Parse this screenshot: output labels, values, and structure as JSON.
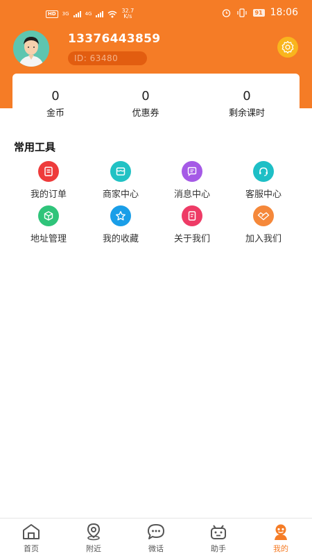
{
  "status_bar": {
    "left_badges": [
      "HD",
      "3G",
      "4G"
    ],
    "speed_value": "32.7",
    "speed_unit": "K/s",
    "battery": "91",
    "time": "18:06"
  },
  "profile": {
    "phone": "13376443859",
    "id_label": "ID: 63480",
    "settings_icon": "gear-icon"
  },
  "stats": [
    {
      "value": "0",
      "label": "金币"
    },
    {
      "value": "0",
      "label": "优惠券"
    },
    {
      "value": "0",
      "label": "剩余课时"
    }
  ],
  "tools": {
    "title": "常用工具",
    "items": [
      {
        "label": "我的订单",
        "icon": "order-icon",
        "color": "#ee3b3b"
      },
      {
        "label": "商家中心",
        "icon": "shop-icon",
        "color": "#21c2c4"
      },
      {
        "label": "消息中心",
        "icon": "message-icon",
        "color": "#a55ae6"
      },
      {
        "label": "客服中心",
        "icon": "headset-icon",
        "color": "#1ebfc6"
      },
      {
        "label": "地址管理",
        "icon": "box-icon",
        "color": "#2fc47a"
      },
      {
        "label": "我的收藏",
        "icon": "star-icon",
        "color": "#1a9ee8"
      },
      {
        "label": "关于我们",
        "icon": "document-icon",
        "color": "#ee3b66"
      },
      {
        "label": "加入我们",
        "icon": "handshake-icon",
        "color": "#f5883a"
      }
    ]
  },
  "bottom_nav": {
    "items": [
      {
        "label": "首页",
        "icon": "home-icon"
      },
      {
        "label": "附近",
        "icon": "location-icon"
      },
      {
        "label": "微话",
        "icon": "chat-icon"
      },
      {
        "label": "助手",
        "icon": "robot-icon"
      },
      {
        "label": "我的",
        "icon": "profile-icon",
        "active": true
      }
    ],
    "active_color": "#f57c26"
  },
  "colors": {
    "header": "#f57c26",
    "id_badge": "#e25d10",
    "settings_button": "#f9b51d"
  }
}
